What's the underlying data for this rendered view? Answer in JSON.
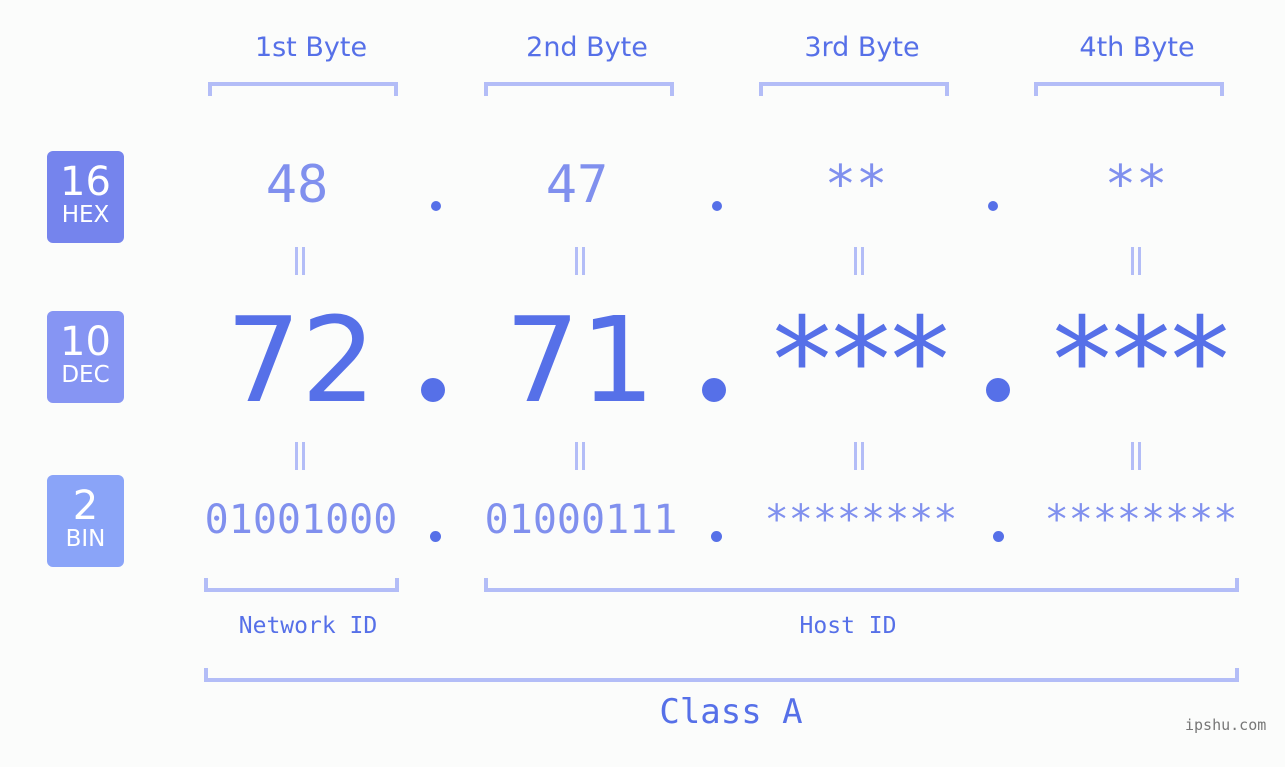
{
  "bytes": [
    {
      "label": "1st Byte",
      "hex": "48",
      "dec": "72",
      "bin": "01001000"
    },
    {
      "label": "2nd Byte",
      "hex": "47",
      "dec": "71",
      "bin": "01000111"
    },
    {
      "label": "3rd Byte",
      "hex": "**",
      "dec": "***",
      "bin": "********"
    },
    {
      "label": "4th Byte",
      "hex": "**",
      "dec": "***",
      "bin": "********"
    }
  ],
  "badges": {
    "hex": {
      "num": "16",
      "base": "HEX",
      "color": "#7584ed"
    },
    "dec": {
      "num": "10",
      "base": "DEC",
      "color": "#8695f3"
    },
    "bin": {
      "num": "2",
      "base": "BIN",
      "color": "#8aa4f8"
    }
  },
  "labels": {
    "network_id": "Network ID",
    "host_id": "Host ID",
    "class": "Class A"
  },
  "watermark": "ipshu.com",
  "colors": {
    "accent": "#5670e8",
    "light_accent": "#8090ee",
    "bracket": "#b3bdf7",
    "background": "#fbfcfb"
  }
}
